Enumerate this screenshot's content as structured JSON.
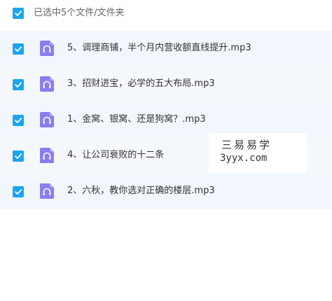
{
  "header": {
    "selection_label": "已选中5个文件/文件夹",
    "select_all_checked": true
  },
  "files": [
    {
      "name": "5、调理商铺，半个月内营收额直线提升.mp3",
      "checked": true,
      "icon": "audio-headphones-icon"
    },
    {
      "name": "3、招财进宝，必学的五大布局.mp3",
      "checked": true,
      "icon": "audio-headphones-icon"
    },
    {
      "name": "1、金窝、银窝、还是狗窝？.mp3",
      "checked": true,
      "icon": "audio-headphones-icon"
    },
    {
      "name": "4、让公司衰败的十二条",
      "checked": true,
      "icon": "audio-headphones-icon"
    },
    {
      "name": "2、六秋，教你选对正确的楼层.mp3",
      "checked": true,
      "icon": "audio-headphones-icon"
    }
  ],
  "watermark": {
    "title": "三易易学",
    "url": "3yyx.com"
  },
  "colors": {
    "checkbox": "#1ba4f0",
    "row_background": "#f1f7fc",
    "icon_background": "#8c7cf0",
    "text": "#333333",
    "header_text": "#666666"
  }
}
